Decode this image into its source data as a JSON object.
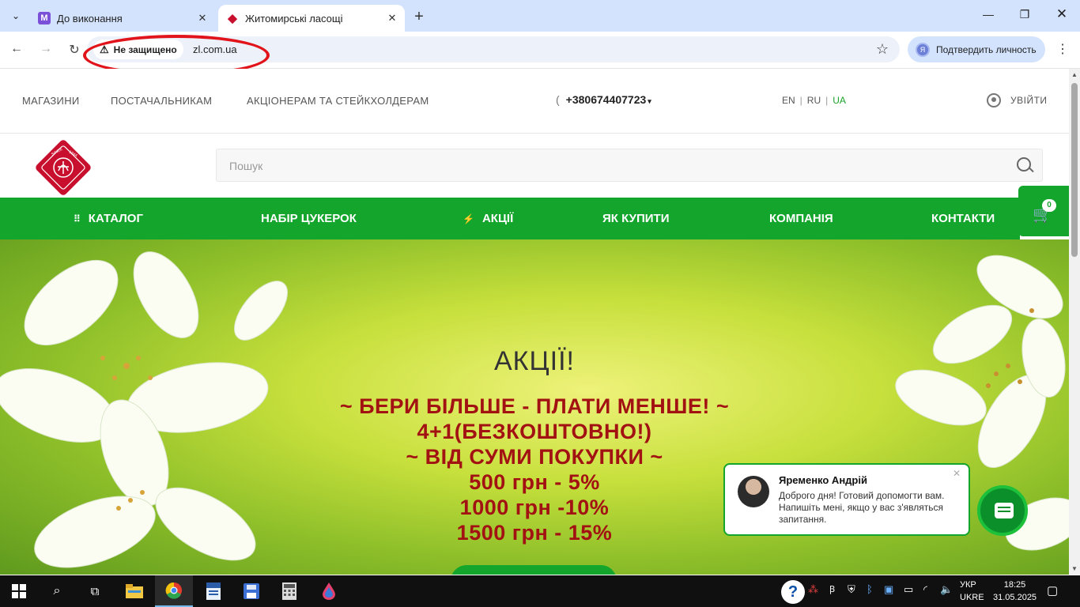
{
  "browser": {
    "tabs": [
      {
        "title": "До виконання",
        "favicon": "M",
        "favicon_color": "#7b50d9"
      },
      {
        "title": "Житомирські ласощі",
        "favicon": "◆",
        "favicon_color": "#c8102e",
        "active": true
      }
    ],
    "security_label": "Не защищено",
    "url": "zl.com.ua",
    "profile_label": "Подтвердить личность",
    "profile_initial": "Я"
  },
  "site": {
    "top_links": [
      "МАГАЗИНИ",
      "ПОСТАЧАЛЬНИКАМ",
      "АКЦІОНЕРАМ ТА СТЕЙКХОЛДЕРАМ"
    ],
    "phone": "+380674407723",
    "languages": [
      "EN",
      "RU",
      "UA"
    ],
    "active_language": "UA",
    "login_label": "УВІЙТИ",
    "search_placeholder": "Пошук",
    "nav": [
      "КАТАЛОГ",
      "НАБІР ЦУКЕРОК",
      "АКЦІЇ",
      "ЯК КУПИТИ",
      "КОМПАНІЯ",
      "КОНТАКТИ"
    ],
    "cart_count": "0",
    "logo_text": {
      "top": "SINCE 1944",
      "bottom": "ZHYTOMYR LASOSHCHI"
    },
    "accent_color": "#14a52c",
    "promo_color": "#a21212"
  },
  "hero": {
    "title": "АКЦІЇ!",
    "lines": [
      "~ БЕРИ БІЛЬШЕ - ПЛАТИ МЕНШЕ! ~",
      "4+1(БЕЗКОШТОВНО!)",
      "~ ВІД СУМИ ПОКУПКИ ~",
      "500 грн - 5%",
      "1000 грн -10%",
      "1500 грн - 15%"
    ]
  },
  "chat": {
    "name": "Яременко Андрій",
    "message": "Доброго дня! Готовий допомогти вам. Напишіть мені, якщо у вас з'являться запитання."
  },
  "taskbar": {
    "lang_line1": "УКР",
    "lang_line2": "UKRE",
    "time": "18:25",
    "date": "31.05.2025"
  }
}
